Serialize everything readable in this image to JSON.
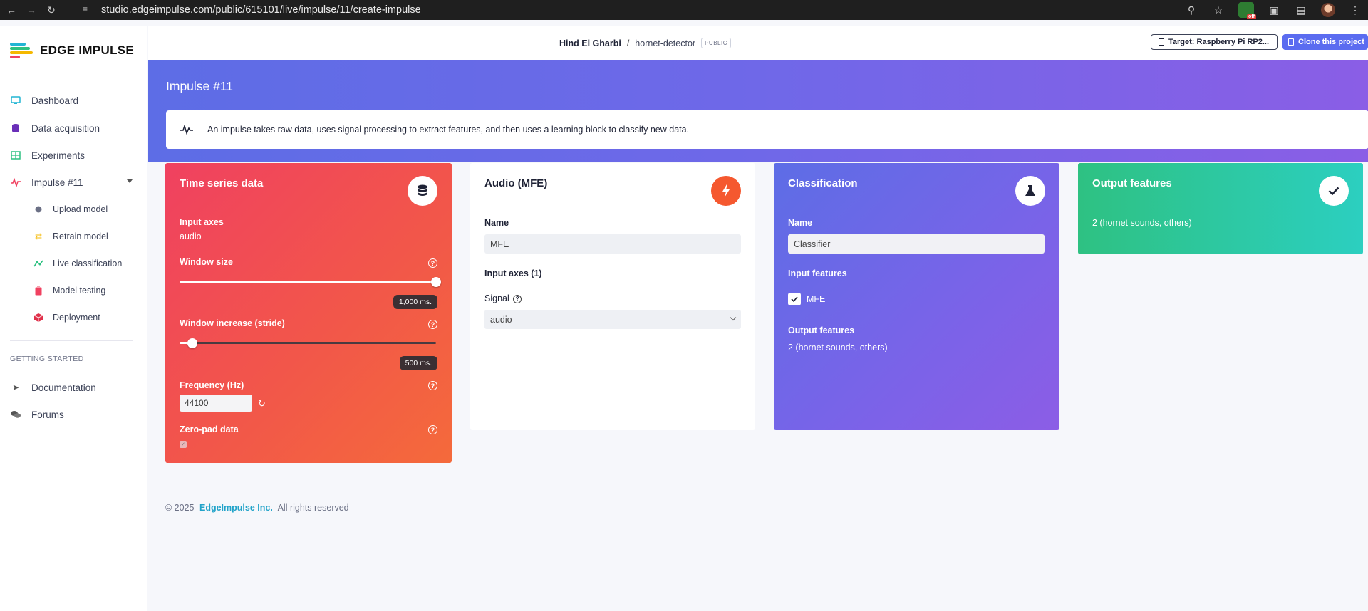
{
  "browser": {
    "url": "studio.edgeimpulse.com/public/615101/live/impulse/11/create-impulse",
    "extension_badge": "off"
  },
  "sidebar": {
    "logo_text": "EDGE IMPULSE",
    "items": [
      {
        "label": "Dashboard",
        "icon": "monitor-icon",
        "color": "#22b5d4"
      },
      {
        "label": "Data acquisition",
        "icon": "database-icon",
        "color": "#6a2fb8"
      },
      {
        "label": "Experiments",
        "icon": "table-icon",
        "color": "#2ec182"
      },
      {
        "label": "Impulse #11",
        "icon": "pulse-icon",
        "color": "#f04160"
      }
    ],
    "sub_items": [
      {
        "label": "Upload model",
        "icon": "dot-icon",
        "color": "#6b7085"
      },
      {
        "label": "Retrain model",
        "icon": "shuffle-icon",
        "color": "#f5b800"
      },
      {
        "label": "Live classification",
        "icon": "graph-icon",
        "color": "#2ec182"
      },
      {
        "label": "Model testing",
        "icon": "clipboard-icon",
        "color": "#f04160"
      },
      {
        "label": "Deployment",
        "icon": "cube-icon",
        "color": "#e0304a"
      }
    ],
    "section_heading": "GETTING STARTED",
    "bottom_items": [
      {
        "label": "Documentation",
        "icon": "rocket-icon"
      },
      {
        "label": "Forums",
        "icon": "comments-icon"
      }
    ]
  },
  "header": {
    "owner": "Hind El Gharbi",
    "separator": "/",
    "project": "hornet-detector",
    "visibility": "PUBLIC",
    "target_label": "Target: Raspberry Pi RP2...",
    "clone_label": "Clone this project"
  },
  "hero": {
    "title": "Impulse #11",
    "info": "An impulse takes raw data, uses signal processing to extract features, and then uses a learning block to classify new data."
  },
  "time_series": {
    "title": "Time series data",
    "input_axes_label": "Input axes",
    "input_axes_value": "audio",
    "window_size_label": "Window size",
    "window_size_value": "1,000 ms.",
    "window_size_level": 1.0,
    "stride_label": "Window increase (stride)",
    "stride_value": "500 ms.",
    "stride_level": 0.05,
    "frequency_label": "Frequency (Hz)",
    "frequency_value": "44100",
    "zero_pad_label": "Zero-pad data",
    "help_glyph": "?"
  },
  "mfe": {
    "title": "Audio (MFE)",
    "name_label": "Name",
    "name_value": "MFE",
    "input_axes_label": "Input axes (1)",
    "signal_label": "Signal",
    "signal_value": "audio"
  },
  "classification": {
    "title": "Classification",
    "name_label": "Name",
    "name_value": "Classifier",
    "input_features_label": "Input features",
    "input_feature_item": "MFE",
    "output_features_label": "Output features",
    "output_features_value": "2 (hornet sounds, others)"
  },
  "output": {
    "title": "Output features",
    "value": "2 (hornet sounds, others)"
  },
  "footer": {
    "copyright": "© 2025",
    "brand": "EdgeImpulse Inc.",
    "rights": "All rights reserved"
  }
}
